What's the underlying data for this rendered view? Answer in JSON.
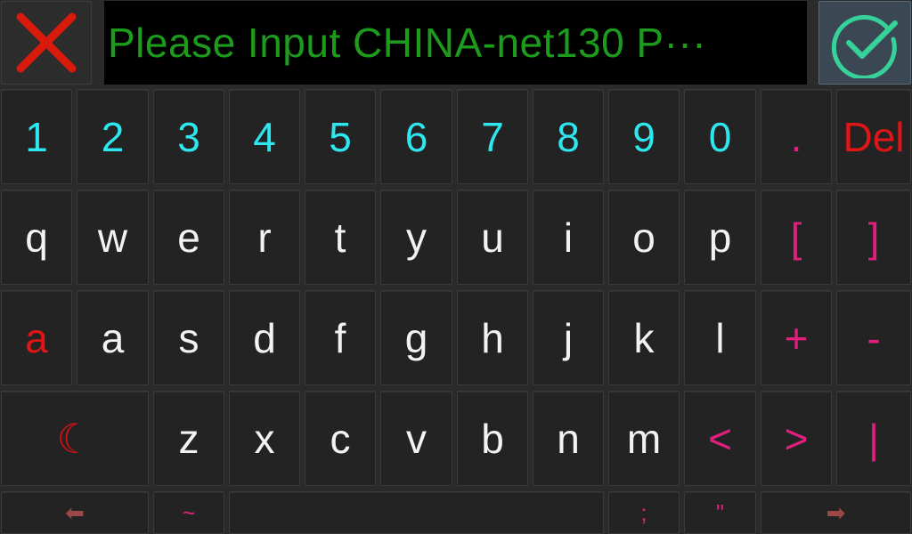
{
  "input": {
    "text": "Please Input CHINA-net130 P···"
  },
  "colors": {
    "digits": "#2ee6ee",
    "letters": "#f2f2f2",
    "symbols": "#e01f7d",
    "delete": "#e01515",
    "input_text": "#1c9b1c",
    "confirm_accent": "#36d29a",
    "cancel_accent": "#d81a0c"
  },
  "icons": {
    "cancel": "close-x-icon",
    "confirm": "check-circle-icon",
    "shift": "crescent-moon-icon",
    "left": "arrow-left-icon",
    "right": "arrow-right-icon"
  },
  "keys": {
    "row1": [
      "1",
      "2",
      "3",
      "4",
      "5",
      "6",
      "7",
      "8",
      "9",
      "0",
      ".",
      "Del"
    ],
    "row2": [
      "q",
      "w",
      "e",
      "r",
      "t",
      "y",
      "u",
      "i",
      "o",
      "p",
      "[",
      "]"
    ],
    "row3": [
      "a",
      "a",
      "s",
      "d",
      "f",
      "g",
      "h",
      "j",
      "k",
      "l",
      "+",
      "-"
    ],
    "row4": [
      "☾",
      "z",
      "x",
      "c",
      "v",
      "b",
      "n",
      "m",
      "<",
      ">",
      "|"
    ],
    "row5": [
      "⬅",
      "~",
      "",
      ";",
      "\"",
      "➡"
    ]
  }
}
